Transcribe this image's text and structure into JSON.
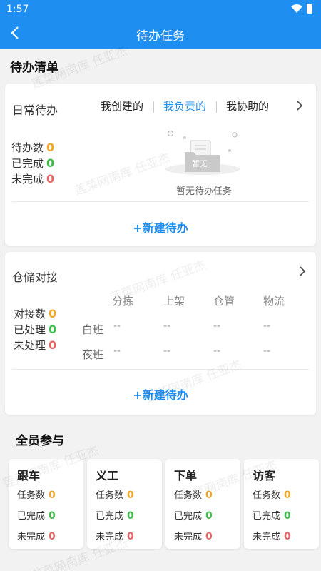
{
  "status": {
    "time": "1:57"
  },
  "header": {
    "title": "待办任务"
  },
  "todo_list": {
    "section_title": "待办清单",
    "daily": {
      "title": "日常待办",
      "tabs": [
        "我创建的",
        "我负责的",
        "我协助的"
      ],
      "active_tab": 1,
      "stats": [
        {
          "label": "待办数",
          "value": "0",
          "color": "#f0a52a"
        },
        {
          "label": "已完成",
          "value": "0",
          "color": "#3dbb4b"
        },
        {
          "label": "未完成",
          "value": "0",
          "color": "#e46464"
        }
      ],
      "empty_badge": "暂无",
      "empty_text": "暂无待办任务",
      "new_button": "+新建待办"
    },
    "warehouse": {
      "title": "仓储对接",
      "stats": [
        {
          "label": "对接数",
          "value": "0"
        },
        {
          "label": "已处理",
          "value": "0"
        },
        {
          "label": "未处理",
          "value": "0"
        }
      ],
      "columns": [
        "分拣",
        "上架",
        "仓管",
        "物流"
      ],
      "rows": [
        {
          "label": "白班",
          "cells": [
            "--",
            "--",
            "--",
            "--"
          ]
        },
        {
          "label": "夜班",
          "cells": [
            "--",
            "--",
            "--",
            "--"
          ]
        }
      ],
      "new_button": "+新建待办"
    }
  },
  "all_staff": {
    "section_title": "全员参与",
    "cards": [
      {
        "title": "跟车",
        "rows": [
          {
            "label": "任务数",
            "value": "0"
          },
          {
            "label": "已完成",
            "value": "0"
          },
          {
            "label": "未完成",
            "value": "0"
          }
        ]
      },
      {
        "title": "义工",
        "rows": [
          {
            "label": "任务数",
            "value": "0"
          },
          {
            "label": "已完成",
            "value": "0"
          },
          {
            "label": "未完成",
            "value": "0"
          }
        ]
      },
      {
        "title": "下单",
        "rows": [
          {
            "label": "任务数",
            "value": "0"
          },
          {
            "label": "已完成",
            "value": "0"
          },
          {
            "label": "未完成",
            "value": "0"
          }
        ]
      },
      {
        "title": "访客",
        "rows": [
          {
            "label": "任务数",
            "value": "0"
          },
          {
            "label": "已完成",
            "value": "0"
          },
          {
            "label": "未完成",
            "value": "0"
          }
        ]
      }
    ]
  },
  "watermark": "莲菜网南库 任亚杰",
  "colors": {
    "accent": "#1e8ef0",
    "orange": "#f0a52a",
    "green": "#3dbb4b",
    "red": "#e46464"
  }
}
